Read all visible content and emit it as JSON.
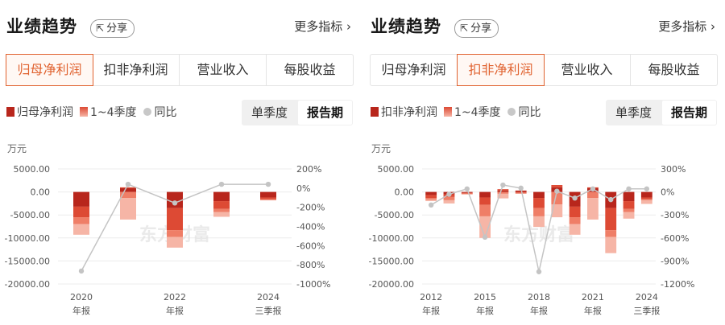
{
  "panels": [
    {
      "title": "业绩趋势",
      "share_label": "分享",
      "more_label": "更多指标",
      "tabs": [
        "归母净利润",
        "扣非净利润",
        "营业收入",
        "每股收益"
      ],
      "active_tab": 0,
      "legend": [
        "归母净利润",
        "1~4季度",
        "同比"
      ],
      "period_options": [
        "单季度",
        "报告期"
      ],
      "active_period": 1,
      "unit": "万元",
      "watermark": "东方财富"
    },
    {
      "title": "业绩趋势",
      "share_label": "分享",
      "more_label": "更多指标",
      "tabs": [
        "归母净利润",
        "扣非净利润",
        "营业收入",
        "每股收益"
      ],
      "active_tab": 1,
      "legend": [
        "扣非净利润",
        "1~4季度",
        "同比"
      ],
      "period_options": [
        "单季度",
        "报告期"
      ],
      "active_period": 1,
      "unit": "万元",
      "watermark": "东方财富"
    }
  ],
  "colors": {
    "q1": "#b8261c",
    "q2": "#dd4a34",
    "q3": "#ef7e67",
    "q4": "#f6b5a6",
    "yoy": "#c4c4c4",
    "accent": "#e0622f"
  },
  "chart_data": [
    {
      "type": "bar",
      "title": "",
      "stacked": true,
      "categories": [
        "2020",
        "2021",
        "2022",
        "2023",
        "2024"
      ],
      "x_tick_labels": [
        {
          "year": "2020",
          "sub": "年报"
        },
        {
          "year": "2022",
          "sub": "年报"
        },
        {
          "year": "2024",
          "sub": "三季报"
        }
      ],
      "series": [
        {
          "name": "1~4季度",
          "quarter": 1,
          "values": [
            -3200,
            800,
            -3500,
            -2000,
            -1200
          ]
        },
        {
          "name": "1~4季度",
          "quarter": 2,
          "values": [
            -2300,
            200,
            -4800,
            -1700,
            -400
          ]
        },
        {
          "name": "1~4季度",
          "quarter": 3,
          "values": [
            -1500,
            -1300,
            -1500,
            -700,
            -200
          ]
        },
        {
          "name": "1~4季度",
          "quarter": 4,
          "values": [
            -2300,
            -4700,
            -2300,
            -1000,
            0
          ]
        }
      ],
      "line": {
        "name": "同比",
        "values": [
          -865,
          40,
          -155,
          40,
          40
        ]
      },
      "y_left": {
        "ticks": [
          5000,
          0,
          -5000,
          -10000,
          -15000,
          -20000
        ],
        "tick_labels": [
          "5000.00",
          "0.00",
          "-5000.00",
          "-10000.00",
          "-15000.00",
          "-20000.00"
        ],
        "ylim": [
          -20000,
          5000
        ]
      },
      "y_right": {
        "ticks": [
          200,
          0,
          -200,
          -400,
          -600,
          -800,
          -1000
        ],
        "tick_labels": [
          "200%",
          "0%",
          "-200%",
          "-400%",
          "-600%",
          "-800%",
          "-1000%"
        ],
        "ylim": [
          -1000,
          200
        ]
      }
    },
    {
      "type": "bar",
      "title": "",
      "stacked": true,
      "categories": [
        "2012",
        "2013",
        "2014",
        "2015",
        "2016",
        "2017",
        "2018",
        "2019",
        "2020",
        "2021",
        "2022",
        "2023",
        "2024"
      ],
      "x_tick_labels": [
        {
          "year": "2012",
          "sub": "年报"
        },
        {
          "year": "2015",
          "sub": "年报"
        },
        {
          "year": "2018",
          "sub": "年报"
        },
        {
          "year": "2021",
          "sub": "年报"
        },
        {
          "year": "2024",
          "sub": "三季报"
        }
      ],
      "series": [
        {
          "name": "1~4季度",
          "quarter": 1,
          "values": [
            -700,
            -500,
            -200,
            -1200,
            300,
            300,
            -1300,
            1000,
            -3200,
            800,
            -3500,
            -2000,
            -1200
          ]
        },
        {
          "name": "1~4季度",
          "quarter": 2,
          "values": [
            -600,
            -600,
            -100,
            -1600,
            300,
            -200,
            -2200,
            500,
            -2300,
            200,
            -4800,
            -1700,
            -400
          ]
        },
        {
          "name": "1~4季度",
          "quarter": 3,
          "values": [
            -400,
            -700,
            -100,
            -2500,
            -400,
            -100,
            -1800,
            -2700,
            -1500,
            -1300,
            -1500,
            -700,
            -200
          ]
        },
        {
          "name": "1~4季度",
          "quarter": 4,
          "values": [
            -300,
            -700,
            -100,
            -4700,
            -1000,
            0,
            -2300,
            -2800,
            -2300,
            -4700,
            -3500,
            -1400,
            -800
          ]
        }
      ],
      "line": {
        "name": "同比",
        "values": [
          -170,
          -30,
          40,
          -590,
          90,
          50,
          -1040,
          10,
          -80,
          40,
          -100,
          40,
          40
        ]
      },
      "y_left": {
        "ticks": [
          5000,
          0,
          -5000,
          -10000,
          -15000,
          -20000
        ],
        "tick_labels": [
          "5000.00",
          "0.00",
          "-5000.00",
          "-10000.00",
          "-15000.00",
          "-20000.00"
        ],
        "ylim": [
          -20000,
          5000
        ]
      },
      "y_right": {
        "ticks": [
          300,
          0,
          -300,
          -600,
          -900,
          -1200
        ],
        "tick_labels": [
          "300%",
          "0%",
          "-300%",
          "-600%",
          "-900%",
          "-1200%"
        ],
        "ylim": [
          -1200,
          300
        ]
      }
    }
  ]
}
